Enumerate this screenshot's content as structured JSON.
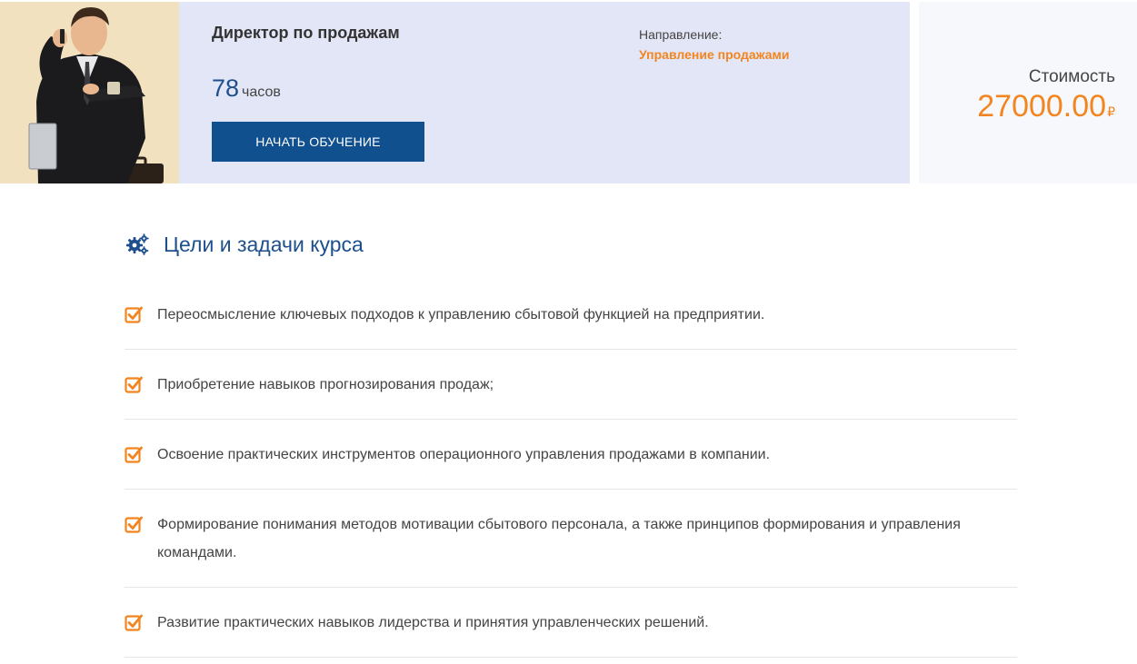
{
  "course": {
    "title": "Директор по продажам",
    "hours_value": "78",
    "hours_unit": "часов",
    "start_button": "НАЧАТЬ ОБУЧЕНИЕ",
    "direction_label": "Направление:",
    "direction_value": "Управление продажами"
  },
  "price": {
    "label": "Стоимость",
    "value": "27000.00",
    "currency": "₽"
  },
  "goals_section": {
    "title": "Цели и задачи курса",
    "items": [
      "Переосмысление ключевых подходов к управлению сбытовой функцией на предприятии.",
      "Приобретение навыков прогнозирования продаж;",
      "Освоение практических инструментов операционного управления продажами в компании.",
      "Формирование понимания методов мотивации сбытового персонала, а также принципов формирования и управления командами.",
      "Развитие практических навыков лидерства и принятия управленческих решений."
    ]
  },
  "colors": {
    "accent_blue": "#1c4f8c",
    "button_blue": "#11508f",
    "accent_orange": "#f2851f",
    "info_bg": "#e3e6f6"
  },
  "icons": {
    "section": "gears-icon",
    "goal": "checkbox-checked-icon",
    "photo": "businessman-photo"
  }
}
